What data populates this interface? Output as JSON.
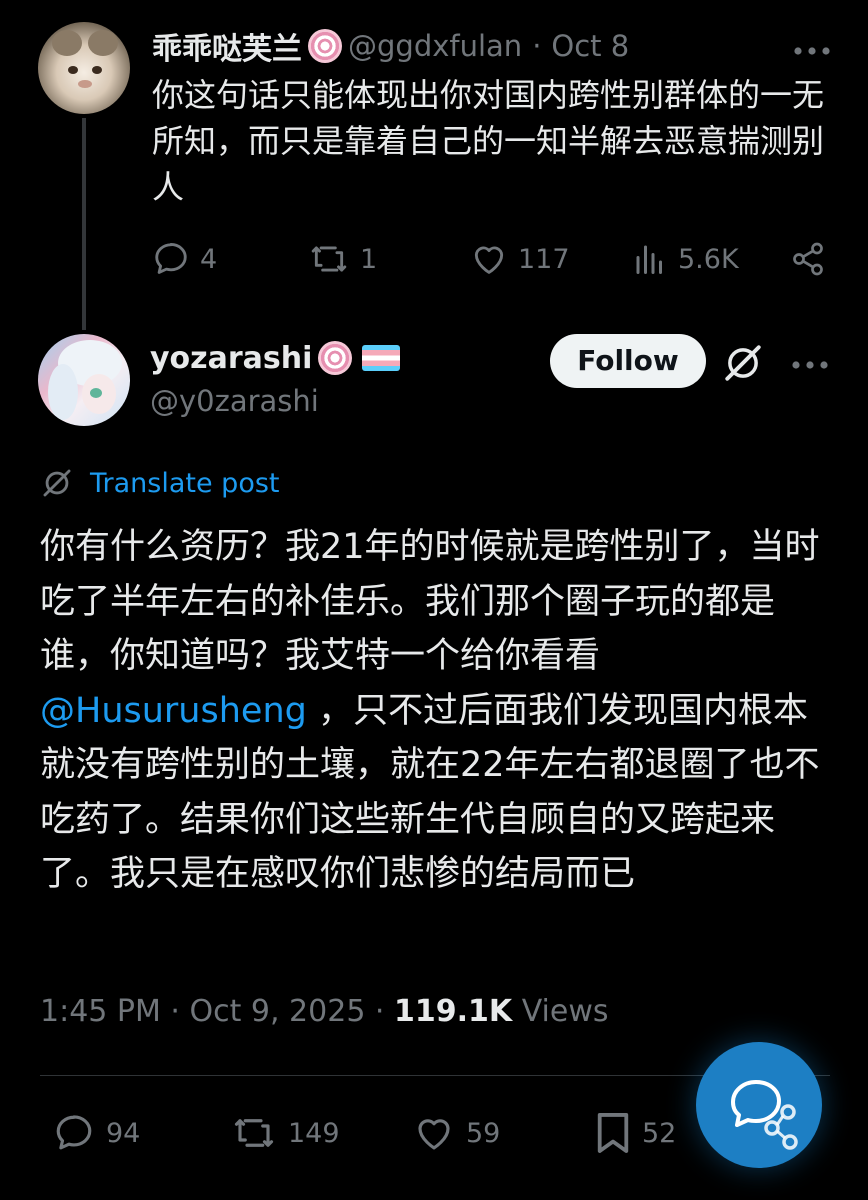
{
  "reply": {
    "display_name": "乖乖哒芙兰",
    "handle": "@ggdxfulan",
    "separator": "·",
    "date": "Oct 8",
    "text": "你这句话只能体现出你对国内跨性别群体的一无所知，而只是靠着自己的一知半解去恶意揣测别人",
    "actions": {
      "replies": "4",
      "reposts": "1",
      "likes": "117",
      "views": "5.6K"
    }
  },
  "post": {
    "display_name": "yozarashi",
    "handle": "@y0zarashi",
    "follow_label": "Follow",
    "translate_label": "Translate post",
    "text_before_mention": "你有什么资历？我21年的时候就是跨性别了，当时吃了半年左右的补佳乐。我们那个圈子玩的都是谁，你知道吗？我艾特一个给你看看",
    "mention": "@Husurusheng",
    "text_after_mention": " ，只不过后面我们发现国内根本就没有跨性别的土壤，就在22年左右都退圈了也不吃药了。结果你们这些新生代自顾自的又跨起来了。我只是在感叹你们悲惨的结局而已",
    "timestamp": "1:45 PM · Oct 9, 2025 · ",
    "views_count": "119.1K",
    "views_label": " Views",
    "actions": {
      "replies": "94",
      "reposts": "149",
      "likes": "59",
      "bookmarks": "52"
    }
  },
  "icons": {
    "more": "more-dots-icon",
    "reply": "speech-bubble-icon",
    "repost": "repost-arrows-icon",
    "like": "heart-icon",
    "views": "bar-chart-icon",
    "share": "share-icon",
    "bookmark": "bookmark-icon",
    "grok": "grok-slash-icon",
    "translate": "translate-slash-icon",
    "compose": "compose-reply-fab-icon"
  },
  "colors": {
    "background": "#000000",
    "text": "#e7e9ea",
    "muted": "#71767b",
    "accent": "#1d9bf0",
    "fab": "#1d7fc4"
  }
}
